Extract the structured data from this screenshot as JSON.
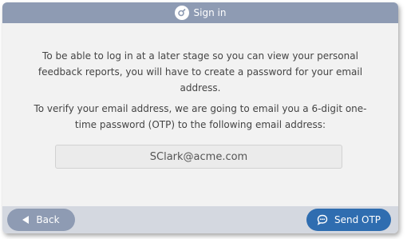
{
  "dialog": {
    "title": "Sign in",
    "title_icon": "sign-in-icon"
  },
  "main": {
    "paragraph1": "To be able to log in at a later stage so you can view your personal feedback reports, you will have to create a password for your email address.",
    "paragraph2": "To verify your email address, we are going to email you a 6-digit one-time password (OTP) to the following email address:",
    "email": "SClark@acme.com"
  },
  "footer": {
    "back_label": "Back",
    "back_icon": "triangle-left-icon",
    "send_label": "Send OTP",
    "send_icon": "chat-bubble-icon"
  },
  "colors": {
    "titlebar": "#8e9bb3",
    "footer": "#d4d8e0",
    "back_button": "#8e9bb3",
    "send_button": "#2f6db0"
  }
}
